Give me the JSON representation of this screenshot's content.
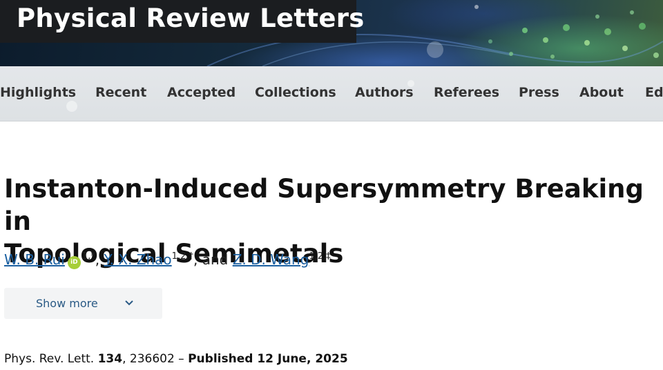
{
  "header": {
    "site_title": "Physical Review Letters"
  },
  "nav": {
    "items": [
      {
        "label": "Highlights"
      },
      {
        "label": "Recent"
      },
      {
        "label": "Accepted"
      },
      {
        "label": "Collections"
      },
      {
        "label": "Authors"
      },
      {
        "label": "Referees"
      },
      {
        "label": "Press"
      },
      {
        "label": "About"
      },
      {
        "label": "Ed"
      }
    ]
  },
  "article": {
    "title_line1": "Instanton-Induced Supersymmetry Breaking in",
    "title_line2": "Topological Semimetals",
    "authors": [
      {
        "name": "W. B. Rui",
        "aff": "1,*",
        "orcid": true
      },
      {
        "name": "Y. X. Zhao",
        "aff": "1,2,†"
      },
      {
        "name": "Z. D. Wang",
        "aff": "1,2,‡"
      }
    ],
    "author_sep_1": ", ",
    "author_sep_2": ", and ",
    "orcid_label": "iD",
    "show_more_label": "Show more",
    "citation": {
      "journal": "Phys. Rev. Lett. ",
      "volume": "134",
      "article_number": ", 236602 – ",
      "published": "Published 12 June, 2025"
    }
  },
  "colors": {
    "link": "#1a5fa0",
    "orcid": "#a6ce39",
    "nav_bg": "#e4e7ea",
    "title_box": "#1b1d20"
  }
}
